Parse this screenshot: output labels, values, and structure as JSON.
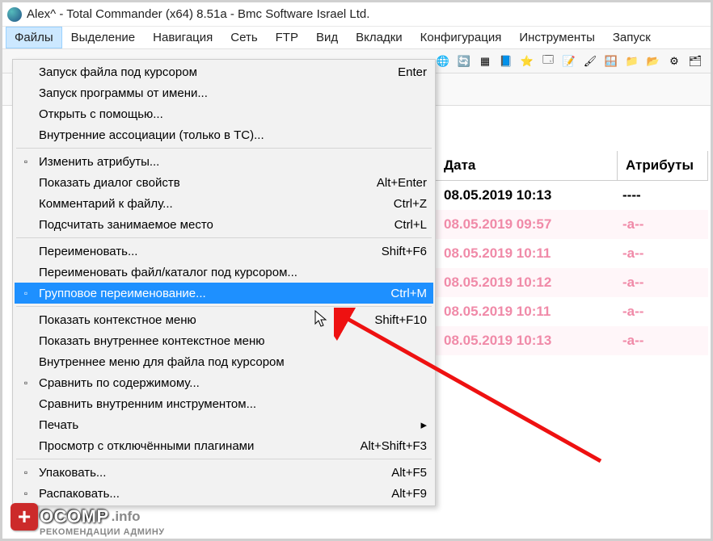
{
  "title": "Alex^ - Total Commander (x64) 8.51a - Bmc Software Israel Ltd.",
  "menubar": [
    "Файлы",
    "Выделение",
    "Навигация",
    "Сеть",
    "FTP",
    "Вид",
    "Вкладки",
    "Конфигурация",
    "Инструменты",
    "Запуск"
  ],
  "menubar_open_index": 0,
  "toolbar_icons": [
    "globe-icon",
    "refresh-icon",
    "grid-icon",
    "book-icon",
    "star-icon",
    "app-icon",
    "notepad-icon",
    "palette-icon",
    "window-icon",
    "folder-green-icon",
    "folder-yellow-icon",
    "gear-icon",
    "stack-icon"
  ],
  "dropdown": [
    {
      "type": "item",
      "label": "Запуск файла под курсором",
      "shortcut": "Enter"
    },
    {
      "type": "item",
      "label": "Запуск программы от имени..."
    },
    {
      "type": "item",
      "label": "Открыть с помощью..."
    },
    {
      "type": "item",
      "label": "Внутренние ассоциации (только в TC)..."
    },
    {
      "type": "sep"
    },
    {
      "type": "item",
      "label": "Изменить атрибуты...",
      "icon": "props-icon"
    },
    {
      "type": "item",
      "label": "Показать диалог свойств",
      "shortcut": "Alt+Enter"
    },
    {
      "type": "item",
      "label": "Комментарий к файлу...",
      "shortcut": "Ctrl+Z"
    },
    {
      "type": "item",
      "label": "Подсчитать занимаемое место",
      "shortcut": "Ctrl+L"
    },
    {
      "type": "sep"
    },
    {
      "type": "item",
      "label": "Переименовать...",
      "shortcut": "Shift+F6"
    },
    {
      "type": "item",
      "label": "Переименовать файл/каталог под курсором..."
    },
    {
      "type": "item",
      "label": "Групповое переименование...",
      "shortcut": "Ctrl+M",
      "highlight": true,
      "icon": "rename-icon"
    },
    {
      "type": "sep"
    },
    {
      "type": "item",
      "label": "Показать контекстное меню",
      "shortcut": "Shift+F10"
    },
    {
      "type": "item",
      "label": "Показать внутреннее контекстное меню"
    },
    {
      "type": "item",
      "label": "Внутреннее меню для файла под курсором"
    },
    {
      "type": "item",
      "label": "Сравнить по содержимому...",
      "icon": "compare-icon"
    },
    {
      "type": "item",
      "label": "Сравнить внутренним инструментом..."
    },
    {
      "type": "item",
      "label": "Печать",
      "submenu": true
    },
    {
      "type": "item",
      "label": "Просмотр с отключёнными плагинами",
      "shortcut": "Alt+Shift+F3"
    },
    {
      "type": "sep"
    },
    {
      "type": "item",
      "label": "Упаковать...",
      "shortcut": "Alt+F5",
      "icon": "pack-icon"
    },
    {
      "type": "item",
      "label": "Распаковать...",
      "shortcut": "Alt+F9",
      "icon": "unpack-icon"
    }
  ],
  "panel": {
    "headers": {
      "date": "Дата",
      "attr": "Атрибуты"
    },
    "rows": [
      {
        "date": "08.05.2019 10:13",
        "attr": "----",
        "style": "dark"
      },
      {
        "date": "08.05.2019 09:57",
        "attr": "-a--",
        "style": "pink"
      },
      {
        "date": "08.05.2019 10:11",
        "attr": "-a--",
        "style": "pink alt"
      },
      {
        "date": "08.05.2019 10:12",
        "attr": "-a--",
        "style": "pink"
      },
      {
        "date": "08.05.2019 10:11",
        "attr": "-a--",
        "style": "pink alt"
      },
      {
        "date": "08.05.2019 10:13",
        "attr": "-a--",
        "style": "pink"
      }
    ]
  },
  "watermark": {
    "brand": "OCOMP",
    "suffix": ".info",
    "sub": "РЕКОМЕНДАЦИИ АДМИНУ",
    "badge": "+"
  }
}
